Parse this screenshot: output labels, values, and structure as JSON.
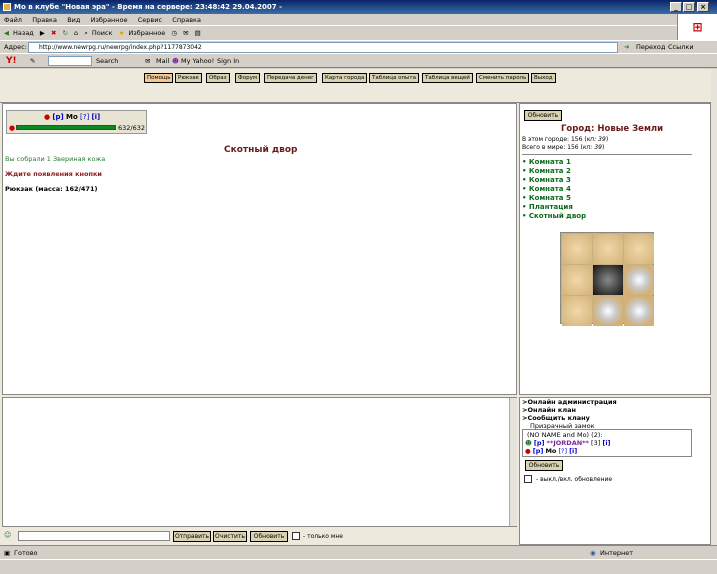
{
  "window": {
    "title": "Мо в клубе \"Новая эра\" - Время на сервере: 23:48:42 29.04.2007 -"
  },
  "menu": [
    "Файл",
    "Правка",
    "Вид",
    "Избранное",
    "Сервис",
    "Справка"
  ],
  "toolbar": {
    "back": "Назад",
    "search": "Поиск",
    "favorites": "Избранное"
  },
  "address": {
    "label": "Адрес:",
    "url": "http://www.newrpg.ru/newrpg/index.php?1177873042",
    "go": "Переход",
    "links": "Ссылки"
  },
  "yahoo": {
    "search": "Search",
    "mail": "Mail",
    "my_yahoo": "My Yahoo!",
    "sign_in": "Sign In"
  },
  "nav": [
    "Помощь",
    "Рюкзак",
    "Образ",
    "Форум",
    "Передача денег",
    "Карта города",
    "Таблица опыта",
    "Таблица вещей",
    "Сменить пароль",
    "Выход"
  ],
  "player": {
    "links_open": "[р]",
    "name": "Мо",
    "level": "[?]",
    "info": "[i]",
    "hp": "632/632",
    "hp_fraction": 1.0
  },
  "main": {
    "title": "Скотный двор",
    "collected": "Вы собрали 1 Звериная кожа",
    "wait": "Ждите появления кнопки",
    "backpack": "Рюкзак (масса: 162/471)"
  },
  "right": {
    "refresh": "Обновить",
    "city": "Город: Новые Земли",
    "in_city": "В этом городе: 156 (",
    "in_city_kp": "кп: 39",
    "in_world": "Всего в мире: 156 (",
    "in_world_kp": "кп: 39",
    "rooms": [
      "Комната 1",
      "Комната 2",
      "Комната 3",
      "Комната 4",
      "Комната 5",
      "Плантация",
      "Скотный двор"
    ]
  },
  "online": {
    "admin": ">Онлайн администрация",
    "clan": ">Онлайн клан",
    "tell_clan": ">Сообщить клану",
    "ghost_castle": "Призрачный замок",
    "users_header": "(NO NAME and Mo) (2):",
    "user1_p": "[р]",
    "user1_name": "**JORDAN**",
    "user1_lvl": "[3]",
    "user1_i": "[i]",
    "user2_p": "[р]",
    "user2_name": "Мо",
    "user2_lvl": "[?]",
    "user2_i": "[i]",
    "refresh": "Обновить",
    "toggle": "- выкл./вкл. обновление"
  },
  "chat": {
    "send": "Отправить",
    "clear": "Очистить",
    "refresh": "Обновить",
    "only_mine": "- только мне"
  },
  "status": {
    "ready": "Готово",
    "zone": "Интернет"
  }
}
